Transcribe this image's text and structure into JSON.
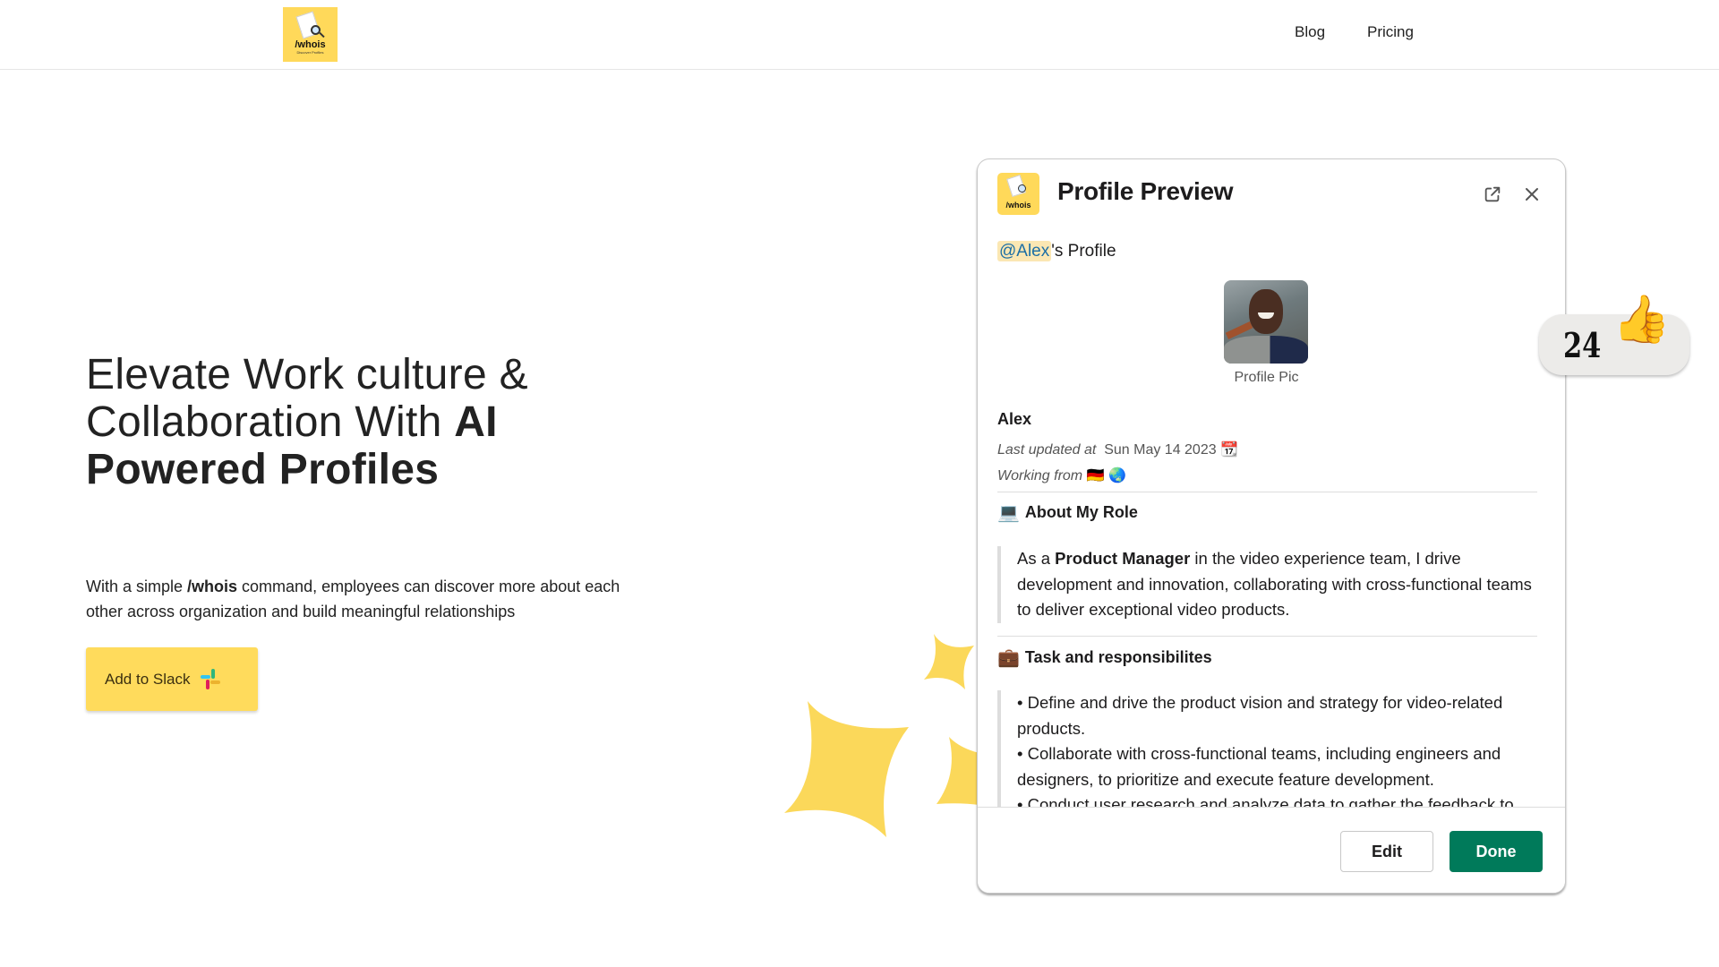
{
  "header": {
    "logo_text": "/whois",
    "logo_tagline": "Discover Profiles",
    "nav": [
      {
        "label": "Blog"
      },
      {
        "label": "Pricing"
      }
    ]
  },
  "hero": {
    "title_light": "Elevate Work culture & Collaboration With ",
    "title_bold": "AI Powered Profiles",
    "desc_before": "With a simple ",
    "desc_command": "/whois",
    "desc_after": " command, employees can discover more about each other across organization and build meaningful relationships",
    "cta_label": "Add to Slack",
    "cta_icon": "slack-logo-icon"
  },
  "panel": {
    "logo_text": "/whois",
    "title": "Profile Preview",
    "external_icon": "external-link-icon",
    "close_icon": "close-icon",
    "mention": "@Alex",
    "mention_suffix": "'s Profile",
    "pic_caption": "Profile Pic",
    "name": "Alex",
    "updated_label": "Last updated at",
    "updated_value": "Sun May 14 2023",
    "updated_emoji": "📆",
    "working_label": "Working from",
    "working_emojis": "🇩🇪 🌏",
    "about": {
      "emoji": "💻",
      "heading": "About My Role",
      "text_before": "As a ",
      "text_bold": "Product Manager",
      "text_after": " in the video experience team, I drive development and innovation, collaborating with cross-functional teams to deliver exceptional video products."
    },
    "tasks": {
      "emoji": "💼",
      "heading": "Task and responsibilites",
      "bullets": [
        "• Define and drive the product vision and strategy for video-related products.",
        "• Collaborate with cross-functional teams, including engineers and designers, to prioritize and execute feature development.",
        "• Conduct user research and analyze data to gather the feedback to"
      ]
    },
    "edit_label": "Edit",
    "done_label": "Done"
  },
  "reaction": {
    "count": "24",
    "emoji": "👍"
  },
  "colors": {
    "brand_yellow": "#ffd95a",
    "done_green": "#007a5a",
    "mention_bg": "#fbe7b3",
    "mention_text": "#1d6fa5"
  }
}
